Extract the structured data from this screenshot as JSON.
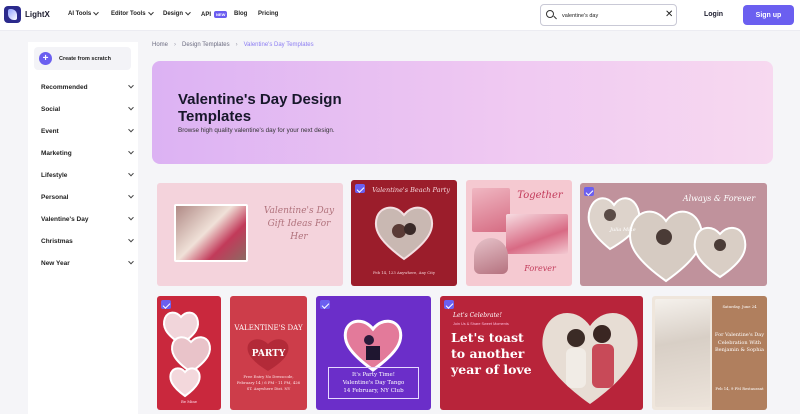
{
  "app": {
    "name": "LightX"
  },
  "nav": {
    "items": [
      {
        "label": "AI Tools",
        "has_menu": true
      },
      {
        "label": "Editor Tools",
        "has_menu": true
      },
      {
        "label": "Design",
        "has_menu": true
      },
      {
        "label": "API",
        "badge": "NEW",
        "has_menu": false
      },
      {
        "label": "Blog",
        "has_menu": false
      },
      {
        "label": "Pricing",
        "has_menu": false
      }
    ]
  },
  "search": {
    "value": "valentine's day"
  },
  "auth": {
    "login": "Login",
    "signup": "Sign up"
  },
  "sidebar": {
    "create_label": "Create from scratch",
    "items": [
      {
        "label": "Recommended"
      },
      {
        "label": "Social"
      },
      {
        "label": "Event"
      },
      {
        "label": "Marketing"
      },
      {
        "label": "Lifestyle"
      },
      {
        "label": "Personal"
      },
      {
        "label": "Valentine's Day"
      },
      {
        "label": "Christmas"
      },
      {
        "label": "New Year"
      }
    ]
  },
  "breadcrumb": {
    "home": "Home",
    "section": "Design Templates",
    "current": "Valentine's Day Templates"
  },
  "hero": {
    "title": "Valentine's Day Design Templates",
    "subtitle": "Browse high quality valentine's day for your next design."
  },
  "templates": {
    "gift": {
      "text": "Valentine's Day Gift Ideas For Her"
    },
    "beach": {
      "title": "Valentine's Beach Party",
      "details": "Feb 14, 123 Anywhere, Any City"
    },
    "together": {
      "top": "Together",
      "bottom": "Forever"
    },
    "always": {
      "text": "Always & Forever",
      "names": "Julia Mike"
    },
    "couple_photo": {
      "caption": "Be Mine"
    },
    "party": {
      "title": "VALENTINE'S DAY",
      "party": "PARTY",
      "details": "Free Entry No Dresscode, February 14 / 6 PM - 11 PM, 426 ST. Anywhere Dist. NY"
    },
    "tango": {
      "line1": "It's Party Time!",
      "line2": "Valentine's Day Tango",
      "line3": "14 February, NY Club"
    },
    "toast": {
      "celebrate": "Let's Celebrate!",
      "details": "Join Us & Share Sweet Moments",
      "headline": "Let's toast to another year of love"
    },
    "celebration": {
      "date": "Saturday, June 24",
      "text": "For Valentine's Day Celebration With Benjamin & Sophia",
      "place": "Feb 14, 9 PM Restaurant"
    }
  },
  "colors": {
    "accent": "#6b5ff0",
    "hero_start": "#dcb2f3",
    "hero_end": "#f7d9f0",
    "breadcrumb_current": "#8b7cf2"
  }
}
